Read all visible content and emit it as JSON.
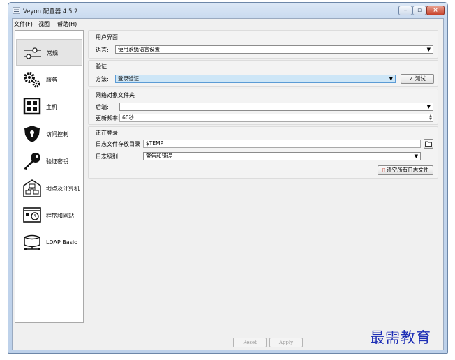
{
  "window": {
    "title": "Veyon 配置器 4.5.2",
    "min": "–",
    "max": "▫",
    "close": "×"
  },
  "menu": [
    "文件(F)",
    "视图",
    "帮助(H)"
  ],
  "sidebar": {
    "items": [
      {
        "label": "常规",
        "icon": "sliders-icon"
      },
      {
        "label": "服务",
        "icon": "gears-icon"
      },
      {
        "label": "主机",
        "icon": "grid-icon"
      },
      {
        "label": "访问控制",
        "icon": "shield-icon"
      },
      {
        "label": "验证密钥",
        "icon": "key-icon"
      },
      {
        "label": "地点及计算机",
        "icon": "network-icon"
      },
      {
        "label": "程序和网站",
        "icon": "window-clock-icon"
      },
      {
        "label": "LDAP Basic",
        "icon": "database-icon"
      }
    ]
  },
  "ui_group": {
    "title": "用户界面",
    "language_label": "语言:",
    "language_value": "使用系统语言设置"
  },
  "auth_group": {
    "title": "验证",
    "method_label": "方法:",
    "method_value": "登录验证",
    "test_button": "✓ 测试"
  },
  "netfolder_group": {
    "title": "网络对象文件夹",
    "backend_label": "后端:",
    "backend_value": "",
    "interval_label": "更新频率:",
    "interval_value": "60秒"
  },
  "logging_group": {
    "title": "正在登录",
    "dir_label": "日志文件存放目录",
    "dir_value": "$TEMP",
    "level_label": "日志级别",
    "level_value": "警告和错误",
    "clear_button": "清空所有日志文件"
  },
  "footer": {
    "reset": "Reset",
    "apply": "Apply"
  },
  "watermark": "最需教育",
  "colors": {
    "accent": "#5b9bd5",
    "watermark": "#1c2db5"
  }
}
